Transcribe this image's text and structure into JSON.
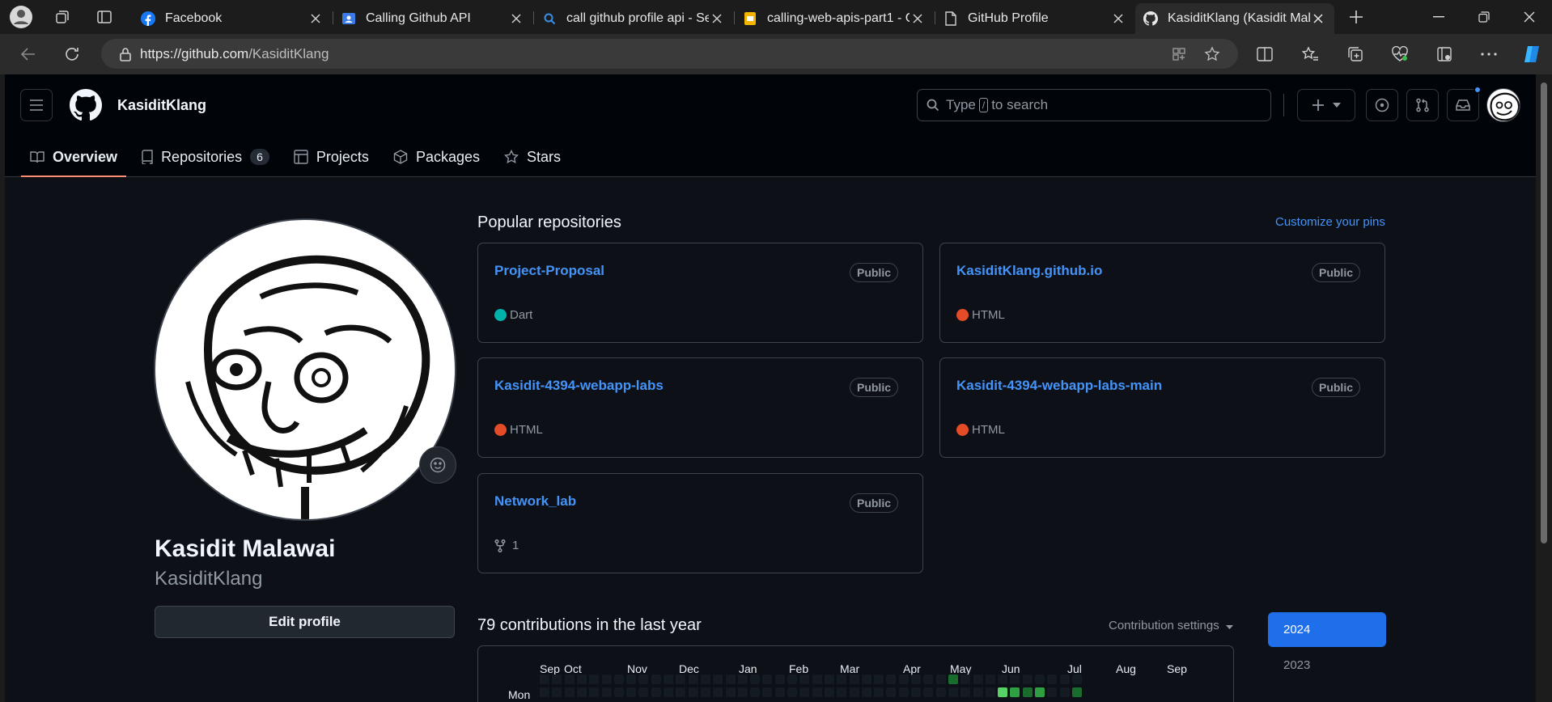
{
  "browser": {
    "tabs": [
      {
        "title": "Facebook"
      },
      {
        "title": "Calling Github API"
      },
      {
        "title": "call github profile api - Se"
      },
      {
        "title": "calling-web-apis-part1 - G"
      },
      {
        "title": "GitHub Profile"
      },
      {
        "title": "KasiditKlang (Kasidit Mala"
      }
    ],
    "url_host": "https://github.com",
    "url_path": "/KasiditKlang"
  },
  "header": {
    "context": "KasiditKlang",
    "search_prefix": "Type",
    "search_key": "/",
    "search_suffix": "to search"
  },
  "nav": {
    "overview": "Overview",
    "repositories": "Repositories",
    "repo_count": "6",
    "projects": "Projects",
    "packages": "Packages",
    "stars": "Stars"
  },
  "profile": {
    "name": "Kasidit Malawai",
    "login": "KasiditKlang",
    "edit_label": "Edit profile"
  },
  "pinned": {
    "title": "Popular repositories",
    "customize": "Customize your pins",
    "repos": [
      {
        "name": "Project-Proposal",
        "visibility": "Public",
        "lang": "Dart",
        "color": "#00b4ab"
      },
      {
        "name": "KasiditKlang.github.io",
        "visibility": "Public",
        "lang": "HTML",
        "color": "#e34c26"
      },
      {
        "name": "Kasidit-4394-webapp-labs",
        "visibility": "Public",
        "lang": "HTML",
        "color": "#e34c26"
      },
      {
        "name": "Kasidit-4394-webapp-labs-main",
        "visibility": "Public",
        "lang": "HTML",
        "color": "#e34c26"
      },
      {
        "name": "Network_lab",
        "visibility": "Public",
        "forks": "1"
      }
    ]
  },
  "contributions": {
    "title": "79 contributions in the last year",
    "settings": "Contribution settings",
    "months": [
      "Sep",
      "Oct",
      "Nov",
      "Dec",
      "Jan",
      "Feb",
      "Mar",
      "Apr",
      "May",
      "Jun",
      "Jul",
      "Aug",
      "Sep"
    ],
    "day_label": "Mon",
    "years": [
      "2024",
      "2023"
    ]
  },
  "colors": {
    "accent": "#4493f8",
    "nav_underline": "#fd8c73",
    "year_selected": "#1f6feb",
    "green_levels": [
      "#151b23",
      "#033a16",
      "#196c2e",
      "#2ea043",
      "#56d364"
    ]
  }
}
